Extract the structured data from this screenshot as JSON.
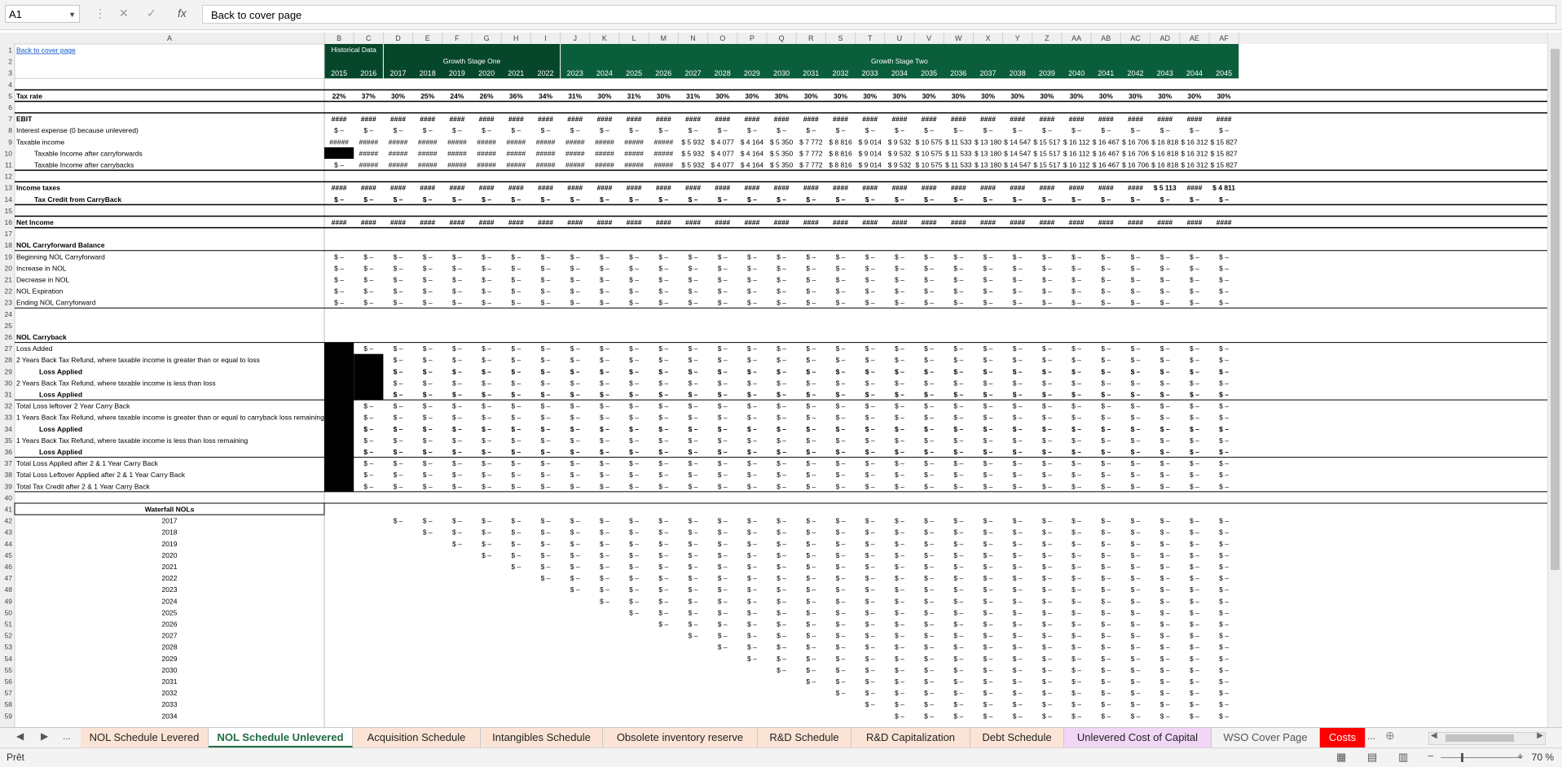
{
  "formula_bar": {
    "name_box": "A1",
    "content": "Back to cover page"
  },
  "icons": {
    "namebox_dropdown": "chevron-down-icon",
    "more": "more-icon",
    "cancel": "close-icon",
    "enter": "checkmark-icon",
    "function": "fx-icon"
  },
  "colors": {
    "header_dark": "#06472b",
    "header_mid": "#0b5e3b",
    "link": "#1155cc",
    "active_tab": "#1f6b41",
    "costs_tab": "#ff0000",
    "cost_capital_tab": "#f1d6f6"
  },
  "columns": [
    "A",
    "B",
    "C",
    "D",
    "E",
    "F",
    "G",
    "H",
    "I",
    "J",
    "K",
    "L",
    "M",
    "N",
    "O",
    "P",
    "Q",
    "R",
    "S",
    "T",
    "U",
    "V",
    "W",
    "X",
    "Y",
    "Z",
    "AA",
    "AB",
    "AC",
    "AD",
    "AE",
    "AF"
  ],
  "header_labels": {
    "historical": "Historical Data",
    "growth_one": "Growth Stage One",
    "growth_two": "Growth Stage Two"
  },
  "years": [
    "2015",
    "2016",
    "2017",
    "2018",
    "2019",
    "2020",
    "2021",
    "2022",
    "2023",
    "2024",
    "2025",
    "2026",
    "2027",
    "2028",
    "2029",
    "2030",
    "2031",
    "2032",
    "2033",
    "2034",
    "2035",
    "2036",
    "2037",
    "2038",
    "2039",
    "2040",
    "2041",
    "2042",
    "2043",
    "2044",
    "2045"
  ],
  "sheet": {
    "link_text": "Back to cover page",
    "tax_rate_label": "Tax rate",
    "tax_rates": [
      "22%",
      "37%",
      "30%",
      "25%",
      "24%",
      "26%",
      "36%",
      "34%",
      "31%",
      "30%",
      "31%",
      "30%",
      "31%",
      "30%",
      "30%",
      "30%",
      "30%",
      "30%",
      "30%",
      "30%",
      "30%",
      "30%",
      "30%",
      "30%",
      "30%",
      "30%",
      "30%",
      "30%",
      "30%",
      "30%",
      "30%"
    ],
    "row_labels": {
      "ebit": "EBIT",
      "interest": "Interest expense (0 because unlevered)",
      "taxable_income": "Taxable income",
      "ti_carryforwards": "Taxable Income after carryforwards",
      "ti_carrybacks": "Taxable Income after carrybacks",
      "income_taxes": "Income taxes",
      "tax_credit": "Tax Credit from CarryBack",
      "net_income": "Net Income",
      "nol_cf_balance": "NOL Carryforward Balance",
      "beginning_nol": "Beginning NOL Carryforward",
      "increase_nol": "Increase in NOL",
      "decrease_nol": "Decrease in NOL",
      "nol_expiration": "NOL Expiration",
      "ending_nol": "Ending NOL Carryforward",
      "nol_carryback": "NOL Carryback",
      "loss_added": "Loss Added",
      "two_year_ge": "2 Years Back Tax Refund, where taxable income is greater than or equal to loss",
      "loss_applied": "Loss Applied",
      "two_year_lt": "2 Years Back Tax Refund, where taxable income is less than loss",
      "total_loss_leftover_2": "Total Loss leftover 2 Year Carry Back",
      "one_year_ge": "1 Years Back Tax Refund, where taxable income is greater than or equal to carryback loss remaining",
      "one_year_lt": "1 Years Back Tax Refund, where taxable income is less than loss remaining",
      "total_loss_applied_21": "Total Loss Applied after 2 & 1 Year Carry Back",
      "total_loss_leftover_21": "Total Loss Leftover Applied after 2 & 1 Year Carry Back",
      "total_tax_credit_21": "Total Tax Credit after 2 & 1 Year Carry Back",
      "waterfall": "Waterfall NOLs"
    },
    "taxable_income_values": [
      "#####",
      "#####",
      "#####",
      "#####",
      "#####",
      "#####",
      "#####",
      "#####",
      "#####",
      "#####",
      "#####",
      "#####",
      "$ 5 932",
      "$ 4 077",
      "$ 4 164",
      "$ 5 350",
      "$ 7 772",
      "$ 8 816",
      "$ 9 014",
      "$ 9 532",
      "$ 10 575",
      "$ 11 533",
      "$ 13 180",
      "$ 14 547",
      "$ 15 517",
      "$ 16 112",
      "$ 16 467",
      "$ 16 706",
      "$ 16 818",
      "$ 16 312",
      "$ 15 827"
    ],
    "income_taxes_end": [
      "$ 5 113",
      "",
      "$ 4 811"
    ],
    "hash4": "####",
    "hash5": "#####",
    "dollar_dash": "$ –",
    "dollar_dash_bold": "$ –",
    "waterfall_years": [
      "2017",
      "2018",
      "2019",
      "2020",
      "2021",
      "2022",
      "2023",
      "2024",
      "2025",
      "2026",
      "2027",
      "2028",
      "2029",
      "2030",
      "2031",
      "2032",
      "2033",
      "2034"
    ]
  },
  "tabs": {
    "ellipsis": "...",
    "items": [
      "NOL Schedule Levered",
      "NOL Schedule Unlevered",
      "Acquisition Schedule",
      "Intangibles Schedule",
      "Obsolete inventory reserve",
      "R&D Schedule",
      "R&D Capitalization",
      "Debt Schedule",
      "Unlevered Cost of Capital",
      "WSO Cover Page",
      "Costs"
    ],
    "active": "NOL Schedule Unlevered"
  },
  "status": {
    "ready": "Prêt",
    "zoom": "70 %"
  }
}
